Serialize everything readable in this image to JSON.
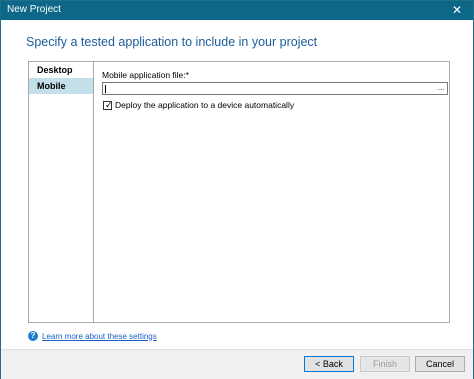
{
  "window": {
    "title": "New Project",
    "close_glyph": "✕"
  },
  "heading": "Specify a tested application to include in your project",
  "nav": {
    "items": [
      {
        "label": "Desktop"
      },
      {
        "label": "Mobile"
      }
    ]
  },
  "mobile": {
    "file_label": "Mobile application file:*",
    "file_value": "",
    "browse_glyph": "...",
    "deploy_checkbox_label": "Deploy the application to a device automatically",
    "deploy_checked": true
  },
  "help": {
    "icon": "question-icon",
    "link_text": "Learn more about these settings"
  },
  "buttons": {
    "back": "< Back",
    "finish": "Finish",
    "cancel": "Cancel"
  },
  "colors": {
    "titlebar": "#0d6786",
    "heading": "#1a5d9a",
    "nav_selected": "#c3dfe9",
    "link": "#1a5ec7"
  }
}
